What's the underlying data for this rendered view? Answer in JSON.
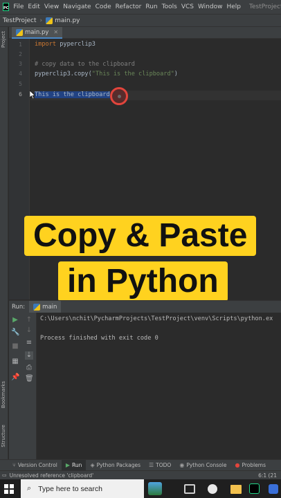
{
  "menubar": {
    "items": [
      "File",
      "Edit",
      "View",
      "Navigate",
      "Code",
      "Refactor",
      "Run",
      "Tools",
      "VCS",
      "Window",
      "Help"
    ],
    "window_title": "TestProject - ma"
  },
  "breadcrumb": {
    "project": "TestProject",
    "file": "main.py"
  },
  "left_strip": {
    "project_label": "Project",
    "bookmarks_label": "Bookmarks",
    "structure_label": "Structure"
  },
  "editor": {
    "tab_label": "main.py",
    "line_numbers": [
      "1",
      "2",
      "3",
      "4",
      "5",
      "6"
    ],
    "lines": {
      "l1_kw": "import",
      "l1_rest": " pyperclip3",
      "l3_comment": "# copy data to the clipboard",
      "l4_code": "pyperclip3.copy(",
      "l4_str": "\"This is the clipboard\"",
      "l4_end": ")",
      "l6_selected": "This is the clipboard"
    }
  },
  "caption": {
    "line1": "Copy & Paste",
    "line2": "in Python"
  },
  "run_panel": {
    "label": "Run:",
    "tab": "main",
    "command": "C:\\Users\\nchit\\PycharmProjects\\TestProject\\venv\\Scripts\\python.ex",
    "result": "Process finished with exit code 0"
  },
  "tool_windows": [
    "Version Control",
    "Run",
    "Python Packages",
    "TODO",
    "Python Console",
    "Problems"
  ],
  "status": {
    "message": "Unresolved reference 'clipboard'",
    "position": "6:1 (21"
  },
  "taskbar": {
    "search_placeholder": "Type here to search"
  },
  "colors": {
    "accent_caption": "#ffd21f",
    "selection": "#214283",
    "keyword": "#cc7832",
    "string": "#6a8759",
    "comment": "#808080"
  }
}
